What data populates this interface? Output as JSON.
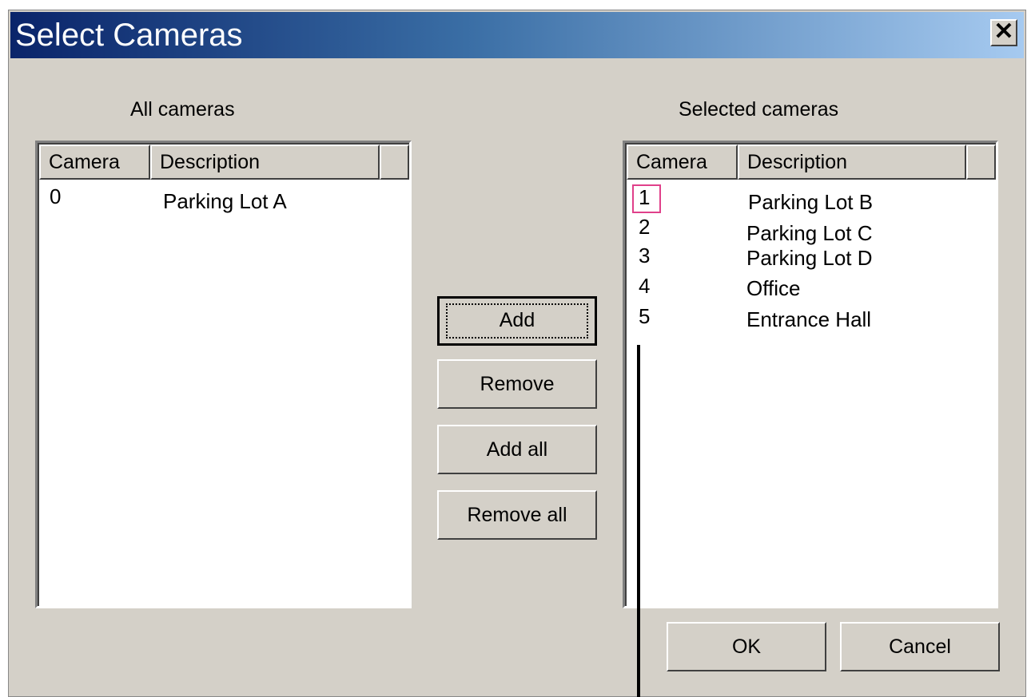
{
  "window": {
    "title": "Select Cameras",
    "close_glyph": "✕"
  },
  "all_cameras": {
    "label": "All cameras",
    "columns": [
      "Camera",
      "Description"
    ],
    "rows": [
      {
        "camera": "0",
        "description": "Parking Lot A"
      }
    ]
  },
  "selected_cameras": {
    "label": "Selected cameras",
    "columns": [
      "Camera",
      "Description"
    ],
    "rows": [
      {
        "camera": "1",
        "description": "Parking Lot B"
      },
      {
        "camera": "2",
        "description": "Parking Lot C"
      },
      {
        "camera": "3",
        "description": "Parking Lot D"
      },
      {
        "camera": "4",
        "description": "Office"
      },
      {
        "camera": "5",
        "description": "Entrance Hall"
      }
    ]
  },
  "buttons": {
    "add": "Add",
    "remove": "Remove",
    "add_all": "Add all",
    "remove_all": "Remove all",
    "ok": "OK",
    "cancel": "Cancel"
  },
  "colors": {
    "title_gradient_start": "#0a246a",
    "title_gradient_end": "#a6caf0",
    "dialog_face": "#d4d0c8",
    "focus_highlight": "#e0408a"
  }
}
